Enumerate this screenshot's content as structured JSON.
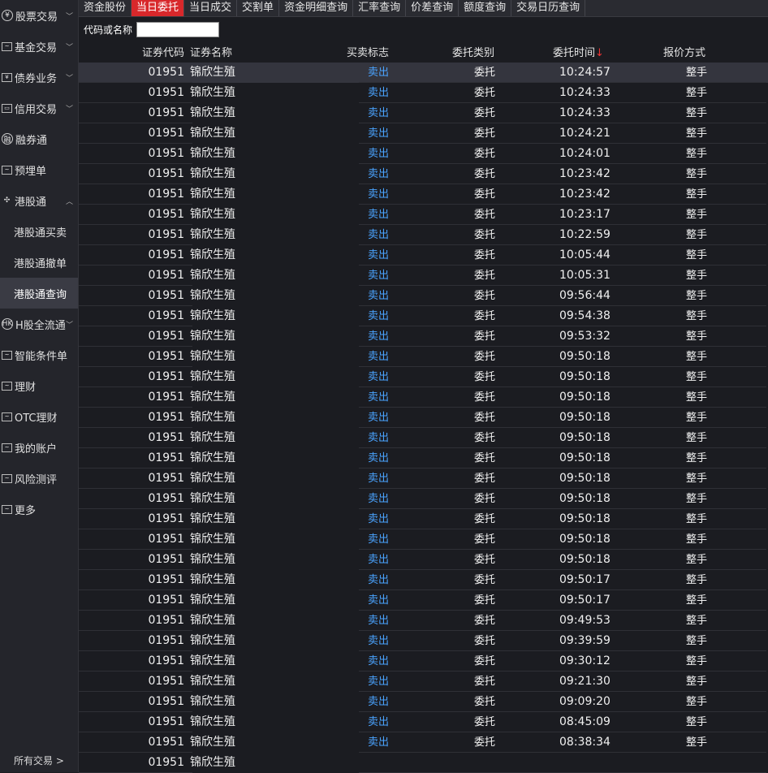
{
  "tabs": [
    "资金股份",
    "当日委托",
    "当日成交",
    "交割单",
    "资金明细查询",
    "汇率查询",
    "价差查询",
    "额度查询",
    "交易日历查询"
  ],
  "active_tab": 1,
  "sidebar": {
    "items": [
      {
        "label": "股票交易",
        "icon": "yen-icon",
        "chevron": "v"
      },
      {
        "label": "基金交易",
        "icon": "chart-icon",
        "chevron": "v"
      },
      {
        "label": "债券业务",
        "icon": "yen-box-icon",
        "chevron": "v"
      },
      {
        "label": "信用交易",
        "icon": "card-icon",
        "chevron": "v"
      },
      {
        "label": "融券通",
        "icon": "rong-icon",
        "chevron": ""
      },
      {
        "label": "预埋单",
        "icon": "chart-icon",
        "chevron": ""
      },
      {
        "label": "港股通",
        "icon": "fan-icon",
        "chevron": "^"
      },
      {
        "label": "港股通买卖",
        "icon": "",
        "chevron": "",
        "sub": true
      },
      {
        "label": "港股通撤单",
        "icon": "",
        "chevron": "",
        "sub": true
      },
      {
        "label": "港股通查询",
        "icon": "",
        "chevron": "",
        "sub": true,
        "active": true
      },
      {
        "label": "H股全流通",
        "icon": "hk-icon",
        "chevron": "v"
      },
      {
        "label": "智能条件单",
        "icon": "chart-icon",
        "chevron": ""
      },
      {
        "label": "理财",
        "icon": "chart-icon",
        "chevron": ""
      },
      {
        "label": "OTC理财",
        "icon": "chart-icon",
        "chevron": ""
      },
      {
        "label": "我的账户",
        "icon": "chart-icon",
        "chevron": ""
      },
      {
        "label": "风险测评",
        "icon": "chart-icon",
        "chevron": ""
      },
      {
        "label": "更多",
        "icon": "chart-icon",
        "chevron": ""
      }
    ],
    "all_trades": "所有交易 >"
  },
  "filter": {
    "label": "代码或名称",
    "value": ""
  },
  "table": {
    "headers": {
      "code": "证券代码",
      "name": "证券名称",
      "flag": "买卖标志",
      "type": "委托类别",
      "time": "委托时间",
      "sort_arrow": "↓",
      "price": "报价方式"
    },
    "rows": [
      {
        "code": "01951",
        "name": "锦欣生殖",
        "flag": "卖出",
        "type": "委托",
        "time": "10:24:57",
        "price": "整手"
      },
      {
        "code": "01951",
        "name": "锦欣生殖",
        "flag": "卖出",
        "type": "委托",
        "time": "10:24:33",
        "price": "整手"
      },
      {
        "code": "01951",
        "name": "锦欣生殖",
        "flag": "卖出",
        "type": "委托",
        "time": "10:24:33",
        "price": "整手"
      },
      {
        "code": "01951",
        "name": "锦欣生殖",
        "flag": "卖出",
        "type": "委托",
        "time": "10:24:21",
        "price": "整手"
      },
      {
        "code": "01951",
        "name": "锦欣生殖",
        "flag": "卖出",
        "type": "委托",
        "time": "10:24:01",
        "price": "整手"
      },
      {
        "code": "01951",
        "name": "锦欣生殖",
        "flag": "卖出",
        "type": "委托",
        "time": "10:23:42",
        "price": "整手"
      },
      {
        "code": "01951",
        "name": "锦欣生殖",
        "flag": "卖出",
        "type": "委托",
        "time": "10:23:42",
        "price": "整手"
      },
      {
        "code": "01951",
        "name": "锦欣生殖",
        "flag": "卖出",
        "type": "委托",
        "time": "10:23:17",
        "price": "整手"
      },
      {
        "code": "01951",
        "name": "锦欣生殖",
        "flag": "卖出",
        "type": "委托",
        "time": "10:22:59",
        "price": "整手"
      },
      {
        "code": "01951",
        "name": "锦欣生殖",
        "flag": "卖出",
        "type": "委托",
        "time": "10:05:44",
        "price": "整手"
      },
      {
        "code": "01951",
        "name": "锦欣生殖",
        "flag": "卖出",
        "type": "委托",
        "time": "10:05:31",
        "price": "整手"
      },
      {
        "code": "01951",
        "name": "锦欣生殖",
        "flag": "卖出",
        "type": "委托",
        "time": "09:56:44",
        "price": "整手"
      },
      {
        "code": "01951",
        "name": "锦欣生殖",
        "flag": "卖出",
        "type": "委托",
        "time": "09:54:38",
        "price": "整手"
      },
      {
        "code": "01951",
        "name": "锦欣生殖",
        "flag": "卖出",
        "type": "委托",
        "time": "09:53:32",
        "price": "整手"
      },
      {
        "code": "01951",
        "name": "锦欣生殖",
        "flag": "卖出",
        "type": "委托",
        "time": "09:50:18",
        "price": "整手"
      },
      {
        "code": "01951",
        "name": "锦欣生殖",
        "flag": "卖出",
        "type": "委托",
        "time": "09:50:18",
        "price": "整手"
      },
      {
        "code": "01951",
        "name": "锦欣生殖",
        "flag": "卖出",
        "type": "委托",
        "time": "09:50:18",
        "price": "整手"
      },
      {
        "code": "01951",
        "name": "锦欣生殖",
        "flag": "卖出",
        "type": "委托",
        "time": "09:50:18",
        "price": "整手"
      },
      {
        "code": "01951",
        "name": "锦欣生殖",
        "flag": "卖出",
        "type": "委托",
        "time": "09:50:18",
        "price": "整手"
      },
      {
        "code": "01951",
        "name": "锦欣生殖",
        "flag": "卖出",
        "type": "委托",
        "time": "09:50:18",
        "price": "整手"
      },
      {
        "code": "01951",
        "name": "锦欣生殖",
        "flag": "卖出",
        "type": "委托",
        "time": "09:50:18",
        "price": "整手"
      },
      {
        "code": "01951",
        "name": "锦欣生殖",
        "flag": "卖出",
        "type": "委托",
        "time": "09:50:18",
        "price": "整手"
      },
      {
        "code": "01951",
        "name": "锦欣生殖",
        "flag": "卖出",
        "type": "委托",
        "time": "09:50:18",
        "price": "整手"
      },
      {
        "code": "01951",
        "name": "锦欣生殖",
        "flag": "卖出",
        "type": "委托",
        "time": "09:50:18",
        "price": "整手"
      },
      {
        "code": "01951",
        "name": "锦欣生殖",
        "flag": "卖出",
        "type": "委托",
        "time": "09:50:18",
        "price": "整手"
      },
      {
        "code": "01951",
        "name": "锦欣生殖",
        "flag": "卖出",
        "type": "委托",
        "time": "09:50:17",
        "price": "整手"
      },
      {
        "code": "01951",
        "name": "锦欣生殖",
        "flag": "卖出",
        "type": "委托",
        "time": "09:50:17",
        "price": "整手"
      },
      {
        "code": "01951",
        "name": "锦欣生殖",
        "flag": "卖出",
        "type": "委托",
        "time": "09:49:53",
        "price": "整手"
      },
      {
        "code": "01951",
        "name": "锦欣生殖",
        "flag": "卖出",
        "type": "委托",
        "time": "09:39:59",
        "price": "整手"
      },
      {
        "code": "01951",
        "name": "锦欣生殖",
        "flag": "卖出",
        "type": "委托",
        "time": "09:30:12",
        "price": "整手"
      },
      {
        "code": "01951",
        "name": "锦欣生殖",
        "flag": "卖出",
        "type": "委托",
        "time": "09:21:30",
        "price": "整手"
      },
      {
        "code": "01951",
        "name": "锦欣生殖",
        "flag": "卖出",
        "type": "委托",
        "time": "09:09:20",
        "price": "整手"
      },
      {
        "code": "01951",
        "name": "锦欣生殖",
        "flag": "卖出",
        "type": "委托",
        "time": "08:45:09",
        "price": "整手"
      },
      {
        "code": "01951",
        "name": "锦欣生殖",
        "flag": "卖出",
        "type": "委托",
        "time": "08:38:34",
        "price": "整手"
      },
      {
        "code": "01951",
        "name": "锦欣生殖",
        "flag": "",
        "type": "",
        "time": "",
        "price": ""
      }
    ],
    "selected_row": 0
  },
  "colors": {
    "accent": "#d8282b",
    "sell": "#4aa3ff",
    "background": "#1b1c21"
  }
}
